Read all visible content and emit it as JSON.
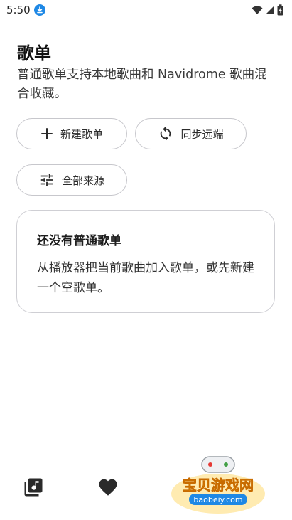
{
  "status_bar": {
    "time": "5:50"
  },
  "header": {
    "title": "歌单",
    "description": "普通歌单支持本地歌曲和 Navidrome 歌曲混合收藏。"
  },
  "actions": {
    "new_playlist": "新建歌单",
    "sync_remote": "同步远端",
    "all_sources": "全部来源"
  },
  "empty_state": {
    "title": "还没有普通歌单",
    "body": "从播放器把当前歌曲加入歌单，或先新建一个空歌单。"
  },
  "watermark": {
    "name": "宝贝游戏网",
    "url": "baobeiy.com"
  },
  "colors": {
    "accent": "#1e88e5",
    "icon": "#2a2a2a",
    "border": "#c7c7cc"
  }
}
